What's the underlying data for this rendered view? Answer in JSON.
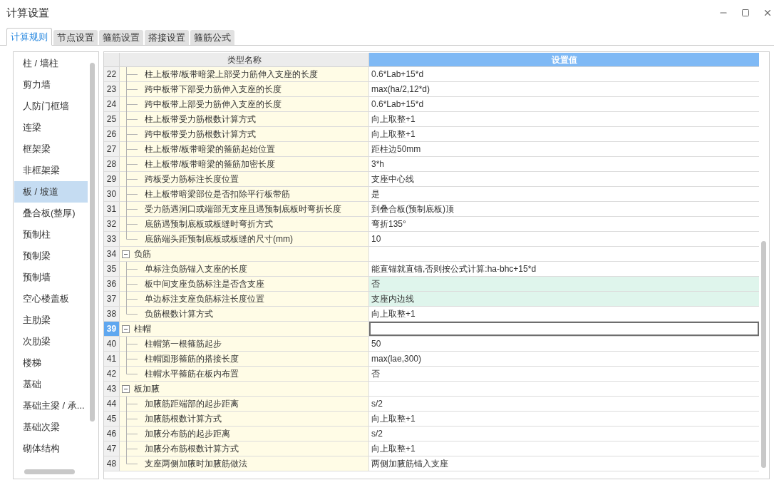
{
  "window": {
    "title": "计算设置"
  },
  "tabs": [
    {
      "label": "计算规则",
      "selected": true
    },
    {
      "label": "节点设置",
      "selected": false
    },
    {
      "label": "箍筋设置",
      "selected": false
    },
    {
      "label": "搭接设置",
      "selected": false
    },
    {
      "label": "箍筋公式",
      "selected": false
    }
  ],
  "sidebar": {
    "items": [
      {
        "label": "柱 / 墙柱",
        "selected": false
      },
      {
        "label": "剪力墙",
        "selected": false
      },
      {
        "label": "人防门框墙",
        "selected": false
      },
      {
        "label": "连梁",
        "selected": false
      },
      {
        "label": "框架梁",
        "selected": false
      },
      {
        "label": "非框架梁",
        "selected": false
      },
      {
        "label": "板 / 坡道",
        "selected": true
      },
      {
        "label": "叠合板(整厚)",
        "selected": false
      },
      {
        "label": "预制柱",
        "selected": false
      },
      {
        "label": "预制梁",
        "selected": false
      },
      {
        "label": "预制墙",
        "selected": false
      },
      {
        "label": "空心楼盖板",
        "selected": false
      },
      {
        "label": "主肋梁",
        "selected": false
      },
      {
        "label": "次肋梁",
        "selected": false
      },
      {
        "label": "楼梯",
        "selected": false
      },
      {
        "label": "基础",
        "selected": false
      },
      {
        "label": "基础主梁 / 承...",
        "selected": false
      },
      {
        "label": "基础次梁",
        "selected": false
      },
      {
        "label": "砌体结构",
        "selected": false
      }
    ]
  },
  "table": {
    "columns": [
      "类型名称",
      "设置值"
    ],
    "groups": [
      {
        "kind": "continued",
        "children": [
          {
            "number": "22",
            "name": "柱上板带/板带暗梁上部受力筋伸入支座的长度",
            "value": "0.6*Lab+15*d",
            "highlighted": false,
            "selected": false
          },
          {
            "number": "23",
            "name": "跨中板带下部受力筋伸入支座的长度",
            "value": "max(ha/2,12*d)",
            "highlighted": false,
            "selected": false
          },
          {
            "number": "24",
            "name": "跨中板带上部受力筋伸入支座的长度",
            "value": "0.6*Lab+15*d",
            "highlighted": false,
            "selected": false
          },
          {
            "number": "25",
            "name": "柱上板带受力筋根数计算方式",
            "value": "向上取整+1",
            "highlighted": false,
            "selected": false
          },
          {
            "number": "26",
            "name": "跨中板带受力筋根数计算方式",
            "value": "向上取整+1",
            "highlighted": false,
            "selected": false
          },
          {
            "number": "27",
            "name": "柱上板带/板带暗梁的箍筋起始位置",
            "value": "距柱边50mm",
            "highlighted": false,
            "selected": false
          },
          {
            "number": "28",
            "name": "柱上板带/板带暗梁的箍筋加密长度",
            "value": "3*h",
            "highlighted": false,
            "selected": false
          },
          {
            "number": "29",
            "name": "跨板受力筋标注长度位置",
            "value": "支座中心线",
            "highlighted": false,
            "selected": false
          },
          {
            "number": "30",
            "name": "柱上板带暗梁部位是否扣除平行板带筋",
            "value": "是",
            "highlighted": false,
            "selected": false
          },
          {
            "number": "31",
            "name": "受力筋遇洞口或端部无支座且遇预制底板时弯折长度",
            "value": "到叠合板(预制底板)顶",
            "highlighted": false,
            "selected": false
          },
          {
            "number": "32",
            "name": "底筋遇预制底板或板缝时弯折方式",
            "value": "弯折135°",
            "highlighted": false,
            "selected": false
          },
          {
            "number": "33",
            "name": "底筋端头距预制底板或板缝的尺寸(mm)",
            "value": "10",
            "highlighted": false,
            "selected": false
          }
        ]
      },
      {
        "kind": "group",
        "number": "34",
        "label": "负筋",
        "expanded": true,
        "selected": false,
        "children": [
          {
            "number": "35",
            "name": "单标注负筋锚入支座的长度",
            "value": "能直锚就直锚,否则按公式计算:ha-bhc+15*d",
            "highlighted": false,
            "selected": false
          },
          {
            "number": "36",
            "name": "板中间支座负筋标注是否含支座",
            "value": "否",
            "highlighted": true,
            "selected": false
          },
          {
            "number": "37",
            "name": "单边标注支座负筋标注长度位置",
            "value": "支座内边线",
            "highlighted": true,
            "selected": false
          },
          {
            "number": "38",
            "name": "负筋根数计算方式",
            "value": "向上取整+1",
            "highlighted": false,
            "selected": false
          }
        ]
      },
      {
        "kind": "group",
        "number": "39",
        "label": "柱帽",
        "expanded": true,
        "selected": true,
        "children": [
          {
            "number": "40",
            "name": "柱帽第一根箍筋起步",
            "value": "50",
            "highlighted": false,
            "selected": false
          },
          {
            "number": "41",
            "name": "柱帽圆形箍筋的搭接长度",
            "value": "max(lae,300)",
            "highlighted": false,
            "selected": false
          },
          {
            "number": "42",
            "name": "柱帽水平箍筋在板内布置",
            "value": "否",
            "highlighted": false,
            "selected": false
          }
        ]
      },
      {
        "kind": "group",
        "number": "43",
        "label": "板加腋",
        "expanded": true,
        "selected": false,
        "children": [
          {
            "number": "44",
            "name": "加腋筋距端部的起步距离",
            "value": "s/2",
            "highlighted": false,
            "selected": false
          },
          {
            "number": "45",
            "name": "加腋筋根数计算方式",
            "value": "向上取整+1",
            "highlighted": false,
            "selected": false
          },
          {
            "number": "46",
            "name": "加腋分布筋的起步距离",
            "value": "s/2",
            "highlighted": false,
            "selected": false
          },
          {
            "number": "47",
            "name": "加腋分布筋根数计算方式",
            "value": "向上取整+1",
            "highlighted": false,
            "selected": false
          },
          {
            "number": "48",
            "name": "支座两侧加腋时加腋筋做法",
            "value": "两侧加腋筋锚入支座",
            "highlighted": false,
            "selected": false
          }
        ]
      }
    ]
  }
}
